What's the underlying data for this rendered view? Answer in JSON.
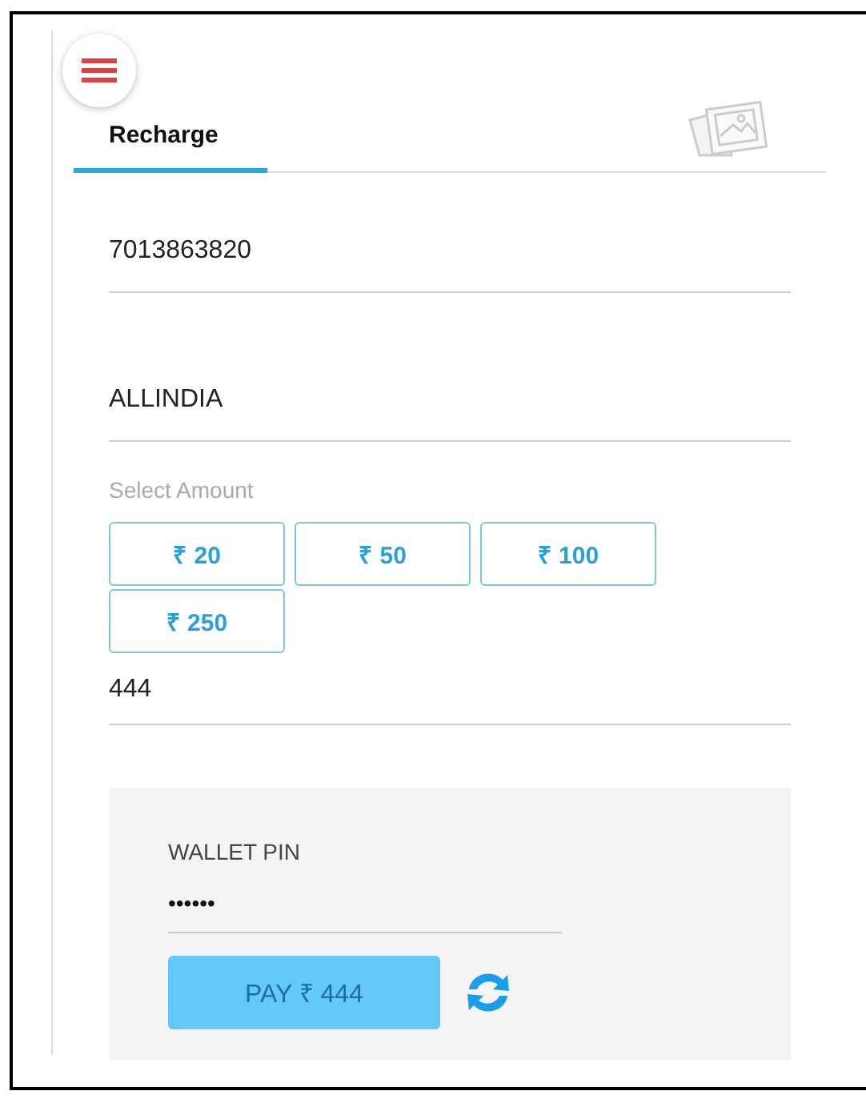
{
  "tabs": [
    {
      "label": "Recharge",
      "selected": true
    }
  ],
  "fields": [
    {
      "value": "7013863820"
    },
    {
      "value": "ALLINDIA"
    }
  ],
  "amount": {
    "label": "Select Amount",
    "options": [
      {
        "label": "₹ 20",
        "selected": false
      },
      {
        "label": "₹ 50",
        "selected": false
      },
      {
        "label": "₹ 100",
        "selected": false
      },
      {
        "label": "₹ 250",
        "selected": false
      }
    ],
    "value": "444"
  },
  "wallet": {
    "label": "WALLET PIN",
    "value": "••••••",
    "pay_button": {
      "label": "PAY ₹ 444",
      "disabled": true
    }
  }
}
